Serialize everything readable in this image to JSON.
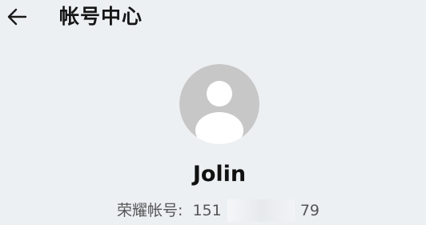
{
  "header": {
    "back_icon": "arrow-left-icon",
    "title": "帐号中心"
  },
  "profile": {
    "avatar_icon": "default-user-avatar",
    "name": "Jolin",
    "account_label": "荣耀帐号:",
    "account_prefix": "151",
    "account_suffix": "79"
  },
  "colors": {
    "background": "#edf0f3",
    "avatar_bg": "#c7c7c7",
    "avatar_fg": "#ffffff",
    "secondary_text": "#555555"
  }
}
